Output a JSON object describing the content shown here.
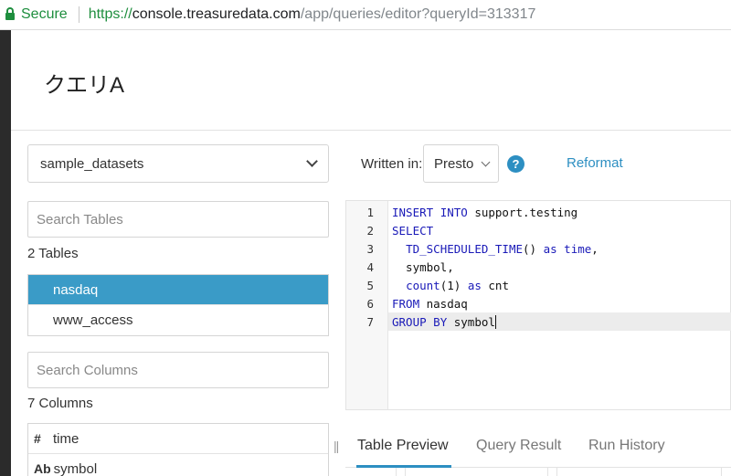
{
  "browser": {
    "secure_label": "Secure",
    "url_scheme": "https://",
    "url_host": "console.treasuredata.com",
    "url_path": "/app/queries/editor?queryId=313317"
  },
  "header": {
    "title": "クエリA"
  },
  "database_select": {
    "value": "sample_datasets"
  },
  "tables": {
    "search_placeholder": "Search Tables",
    "count_label": "2 Tables",
    "items": [
      {
        "label": "nasdaq",
        "active": true
      },
      {
        "label": "www_access",
        "active": false
      }
    ]
  },
  "columns": {
    "search_placeholder": "Search Columns",
    "count_label": "7 Columns",
    "items": [
      {
        "type": "#",
        "label": "time"
      },
      {
        "type": "Ab",
        "label": "symbol"
      }
    ]
  },
  "toolbar": {
    "written_in_label": "Written in:",
    "engine_value": "Presto",
    "help_glyph": "?",
    "reformat_label": "Reformat"
  },
  "editor": {
    "line_numbers": [
      "1",
      "2",
      "3",
      "4",
      "5",
      "6",
      "7"
    ],
    "lines": [
      "INSERT INTO support.testing",
      "SELECT",
      "  TD_SCHEDULED_TIME() as time,",
      "  symbol,",
      "  count(1) as cnt",
      "FROM nasdaq",
      "GROUP BY symbol"
    ],
    "current_line": 7
  },
  "tabs": {
    "splitter_glyph": "||",
    "items": [
      {
        "label": "Table Preview",
        "active": true
      },
      {
        "label": "Query Result",
        "active": false
      },
      {
        "label": "Run History",
        "active": false
      }
    ]
  },
  "colors": {
    "accent": "#2d8fc2",
    "active_row": "#3a9bc7",
    "keyword": "#1a1ab8",
    "secure_green": "#1e8e3e"
  }
}
